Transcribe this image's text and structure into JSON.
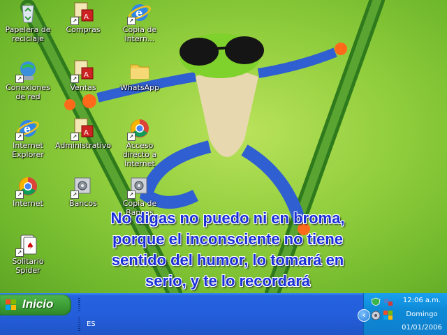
{
  "desktop": {
    "icons": [
      {
        "label": "Papelera de reciclaje",
        "icon": "recycle-bin-icon"
      },
      {
        "label": "Compras",
        "icon": "access-database-icon"
      },
      {
        "label": "Copia de Intern...",
        "icon": "internet-explorer-icon"
      },
      {
        "label": "Conexiones de red",
        "icon": "network-connections-icon"
      },
      {
        "label": "Ventas",
        "icon": "access-database-icon"
      },
      {
        "label": "WhatsApp",
        "icon": "folder-icon"
      },
      {
        "label": "Internet Explorer",
        "icon": "internet-explorer-icon"
      },
      {
        "label": "Administrativo",
        "icon": "access-database-icon"
      },
      {
        "label": "Acceso directo a Internet",
        "icon": "chrome-icon"
      },
      {
        "label": "Internet",
        "icon": "chrome-icon"
      },
      {
        "label": "Bancos",
        "icon": "database-gear-icon"
      },
      {
        "label": "Copia de Bancos",
        "icon": "database-gear-icon"
      },
      {
        "label": "Solitario Spider",
        "icon": "spider-solitaire-icon"
      }
    ],
    "quote": {
      "line1": "No digas no puedo ni en broma,",
      "line2": "porque el inconsciente no tiene",
      "line3": "sentido del humor, lo tomará en",
      "line4": "serio, y te lo recordará"
    }
  },
  "taskbar": {
    "start_label": "Inicio",
    "language": "ES",
    "clock": {
      "time": "12:06 a.m.",
      "day": "Domingo",
      "date": "01/01/2006"
    }
  },
  "colors": {
    "taskbar": "#245edb",
    "start": "#3a9b34",
    "tray": "#0e8ad7",
    "quote": "#1a2fd9",
    "wallpaper": "#8fcd3c"
  }
}
